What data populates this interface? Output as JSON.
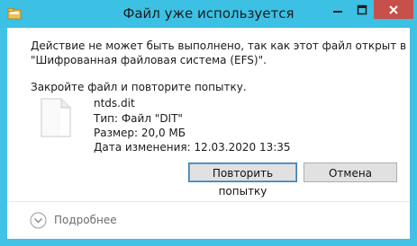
{
  "window": {
    "title": "Файл уже используется",
    "icons": {
      "app": "folder-icon",
      "minimize": "minimize-icon",
      "maximize": "maximize-icon",
      "close": "close-icon"
    }
  },
  "message": {
    "line1": "Действие не может быть выполнено, так как этот файл открыт в",
    "line2": "\"Шифрованная файловая система (EFS)\".",
    "line3": "Закройте файл и повторите попытку."
  },
  "file": {
    "name": "ntds.dit",
    "type": "Тип: Файл \"DIT\"",
    "size": "Размер: 20,0 МБ",
    "modified": "Дата изменения: 12.03.2020 13:35",
    "icon": "document-icon"
  },
  "buttons": {
    "retry": "Повторить попытку",
    "cancel": "Отмена"
  },
  "footer": {
    "more_label": "Подробнее",
    "more_icon": "chevron-down-circle-icon"
  },
  "colors": {
    "titlebar": "#3cc0e4",
    "close_button": "#c7504a",
    "button_face": "#e1e1e1",
    "default_button_border": "#3c7fb1"
  }
}
